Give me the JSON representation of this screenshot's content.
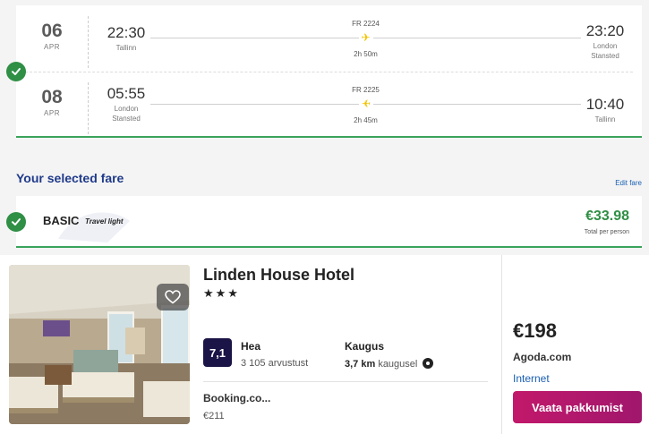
{
  "flights": [
    {
      "day": "06",
      "month": "APR",
      "dep_time": "22:30",
      "dep_city": "Tallinn",
      "flight_no": "FR 2224",
      "duration": "2h 50m",
      "arr_time": "23:20",
      "arr_city": "London\nStansted"
    },
    {
      "day": "08",
      "month": "APR",
      "dep_time": "05:55",
      "dep_city": "London\nStansted",
      "flight_no": "FR 2225",
      "duration": "2h 45m",
      "arr_time": "10:40",
      "arr_city": "Tallinn"
    }
  ],
  "fare": {
    "section_title": "Your selected fare",
    "edit_label": "Edit fare",
    "name": "BASIC",
    "subtitle": "Travel light",
    "price": "€33.98",
    "price_note": "Total per person"
  },
  "hotel": {
    "name": "Linden House Hotel",
    "stars": "★★★",
    "rating": "7,1",
    "rating_label": "Hea",
    "reviews": "3 105 arvustust",
    "distance_label": "Kaugus",
    "distance_value": "3,7 km",
    "distance_suffix": "kaugusel",
    "alt_site": "Booking.co...",
    "alt_price": "€211",
    "price": "€198",
    "provider": "Agoda.com",
    "amenity": "Internet",
    "cta": "Vaata pakkumist"
  },
  "colors": {
    "accent_green": "#2f8f45",
    "title_blue": "#1f3a8a",
    "cta_magenta": "#c2186b",
    "rating_navy": "#1b1446"
  }
}
